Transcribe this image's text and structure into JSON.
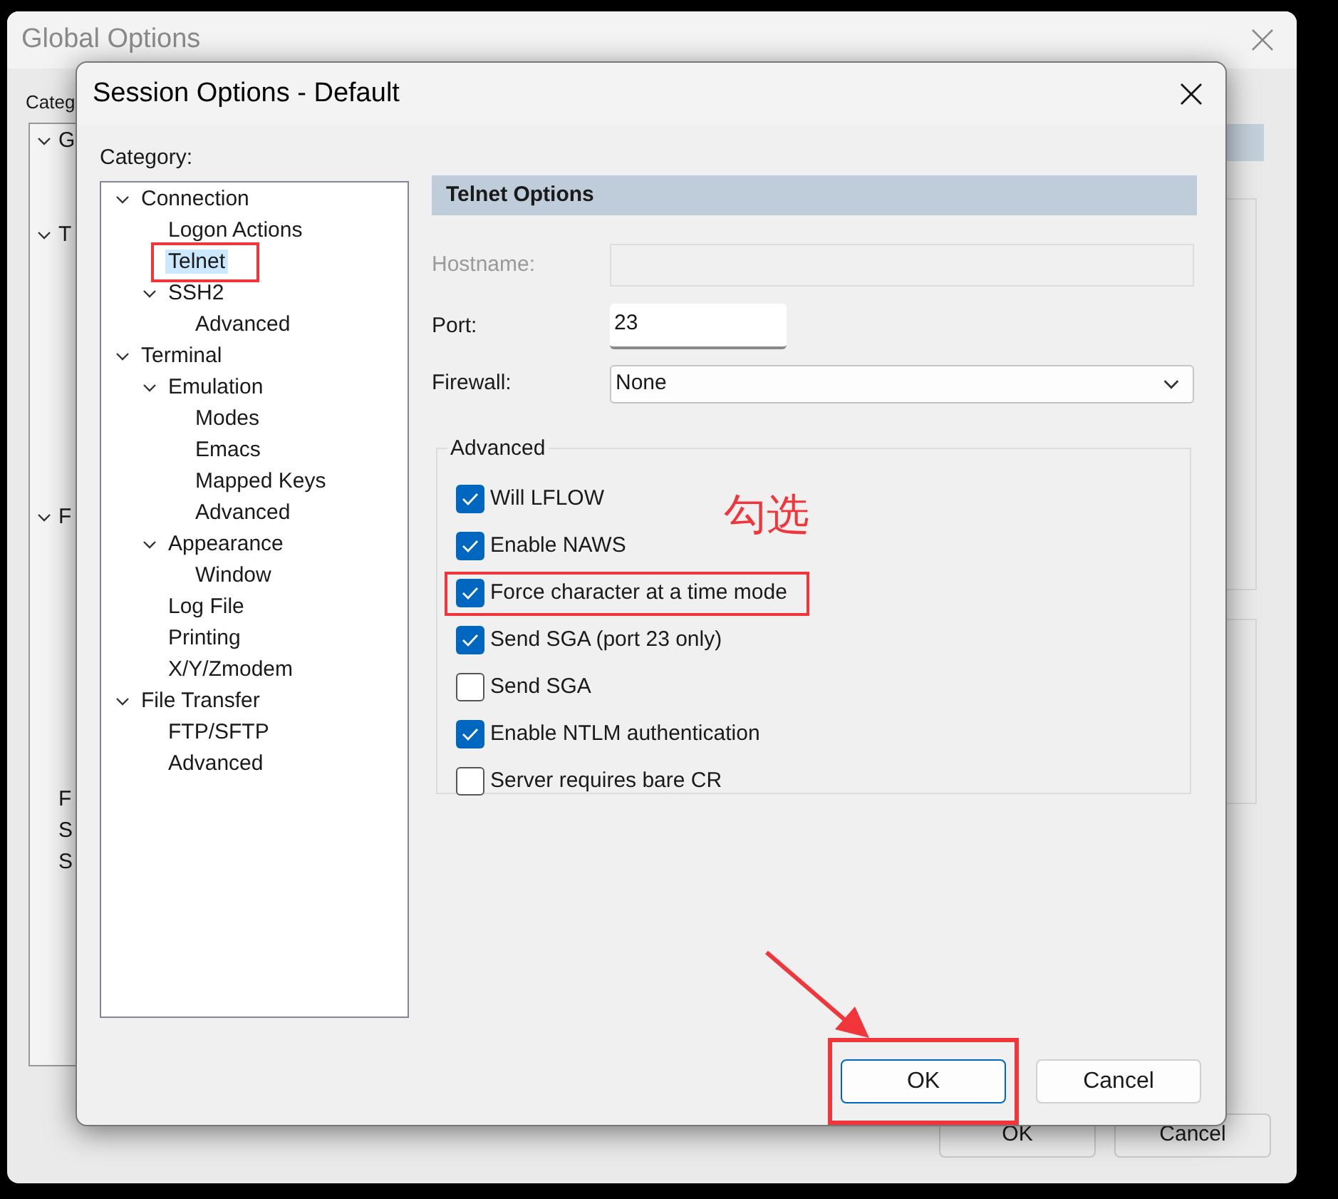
{
  "background_window": {
    "title": "Global Options",
    "category_label": "Categ",
    "tree": [
      {
        "text": "G",
        "kind": "group"
      },
      {
        "text": "T",
        "kind": "group"
      },
      {
        "text": "F",
        "kind": "group"
      },
      {
        "text": "F",
        "kind": "leaf"
      },
      {
        "text": "S",
        "kind": "leaf"
      },
      {
        "text": "S",
        "kind": "leaf"
      }
    ],
    "buttons": [
      "OK",
      "Cancel"
    ]
  },
  "dialog": {
    "title": "Session Options - Default",
    "category_label": "Category:",
    "tree": [
      {
        "text": "Connection",
        "selected": false,
        "highlighted": false,
        "children": [
          {
            "text": "Logon Actions",
            "selected": false,
            "highlighted": false
          },
          {
            "text": "Telnet",
            "selected": true,
            "highlighted": true
          },
          {
            "text": "SSH2",
            "selected": false,
            "highlighted": false,
            "children": [
              {
                "text": "Advanced",
                "selected": false,
                "highlighted": false
              }
            ]
          }
        ]
      },
      {
        "text": "Terminal",
        "selected": false,
        "highlighted": false,
        "children": [
          {
            "text": "Emulation",
            "selected": false,
            "highlighted": false,
            "children": [
              {
                "text": "Modes",
                "selected": false,
                "highlighted": false
              },
              {
                "text": "Emacs",
                "selected": false,
                "highlighted": false
              },
              {
                "text": "Mapped Keys",
                "selected": false,
                "highlighted": false
              },
              {
                "text": "Advanced",
                "selected": false,
                "highlighted": false
              }
            ]
          },
          {
            "text": "Appearance",
            "selected": false,
            "highlighted": false,
            "children": [
              {
                "text": "Window",
                "selected": false,
                "highlighted": false
              }
            ]
          },
          {
            "text": "Log File",
            "selected": false,
            "highlighted": false
          },
          {
            "text": "Printing",
            "selected": false,
            "highlighted": false
          },
          {
            "text": "X/Y/Zmodem",
            "selected": false,
            "highlighted": false
          }
        ]
      },
      {
        "text": "File Transfer",
        "selected": false,
        "highlighted": false,
        "children": [
          {
            "text": "FTP/SFTP",
            "selected": false,
            "highlighted": false
          },
          {
            "text": "Advanced",
            "selected": false,
            "highlighted": false
          }
        ]
      }
    ],
    "panel": {
      "heading": "Telnet Options",
      "hostname": {
        "label": "Hostname:",
        "disabled": true
      },
      "port": {
        "label": "Port:",
        "value": "23"
      },
      "firewall": {
        "label": "Firewall:",
        "value": "None"
      },
      "advanced": {
        "label": "Advanced",
        "options": [
          {
            "label": "Will LFLOW",
            "checked": true,
            "highlighted": false
          },
          {
            "label": "Enable NAWS",
            "checked": true,
            "highlighted": false
          },
          {
            "label": "Force character at a time mode",
            "checked": true,
            "highlighted": true
          },
          {
            "label": "Send SGA (port 23 only)",
            "checked": true,
            "highlighted": false
          },
          {
            "label": "Send SGA",
            "checked": false,
            "highlighted": false
          },
          {
            "label": "Enable NTLM authentication",
            "checked": true,
            "highlighted": false
          },
          {
            "label": "Server requires bare CR",
            "checked": false,
            "highlighted": false
          }
        ]
      }
    },
    "buttons": [
      {
        "label": "OK",
        "default": true,
        "highlighted": true
      },
      {
        "label": "Cancel",
        "default": false,
        "highlighted": false
      }
    ]
  },
  "annotation": {
    "note": "勾选"
  }
}
